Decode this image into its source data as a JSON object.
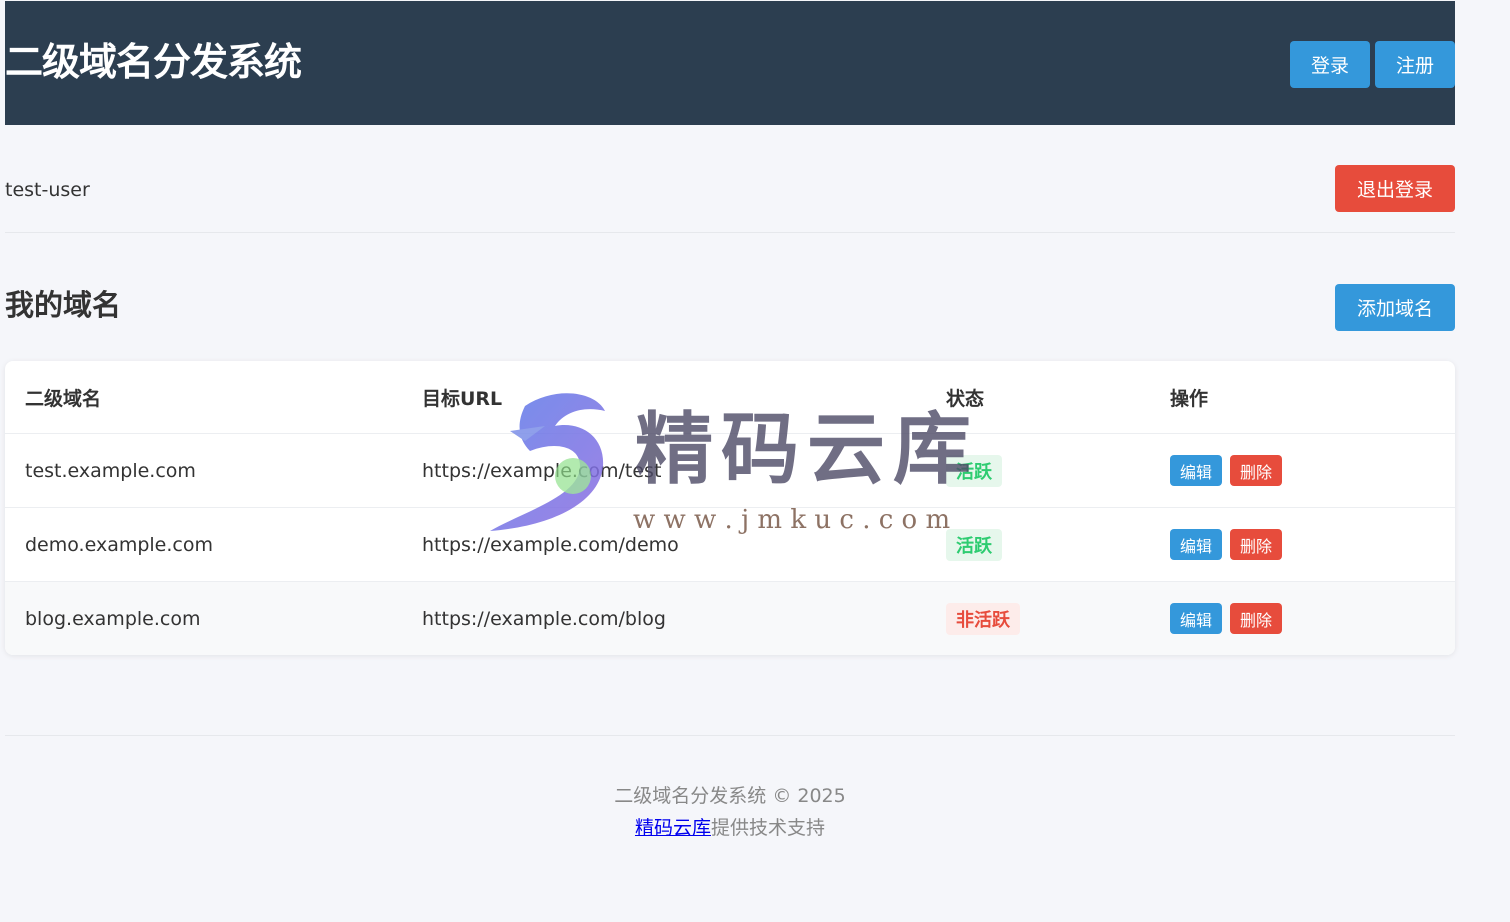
{
  "header": {
    "title": "二级域名分发系统",
    "login_label": "登录",
    "register_label": "注册"
  },
  "user": {
    "name": "test-user",
    "logout_label": "退出登录"
  },
  "domains": {
    "title": "我的域名",
    "add_label": "添加域名",
    "columns": [
      "二级域名",
      "目标URL",
      "状态",
      "操作"
    ],
    "rows": [
      {
        "subdomain": "test.example.com",
        "target": "https://example.com/test",
        "status": "活跃",
        "edit": "编辑",
        "delete": "删除"
      },
      {
        "subdomain": "demo.example.com",
        "target": "https://example.com/demo",
        "status": "活跃",
        "edit": "编辑",
        "delete": "删除"
      },
      {
        "subdomain": "blog.example.com",
        "target": "https://example.com/blog",
        "status": "非活跃",
        "edit": "编辑",
        "delete": "删除"
      }
    ]
  },
  "footer": {
    "copyright": "二级域名分发系统 © 2025",
    "link_text": "精码云库",
    "support_text": "提供技术支持"
  },
  "watermark": {
    "brand": "精码云库",
    "url": "w w w . j m k u c . c o m"
  },
  "colors": {
    "header_bg": "#2c3e50",
    "primary": "#3498db",
    "danger": "#e74c3c",
    "success": "#2ecc71"
  }
}
